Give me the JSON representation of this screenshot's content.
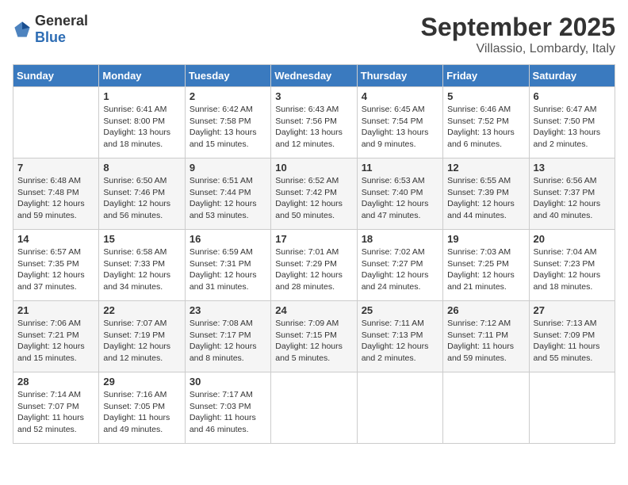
{
  "header": {
    "logo_general": "General",
    "logo_blue": "Blue",
    "month": "September 2025",
    "location": "Villassio, Lombardy, Italy"
  },
  "weekdays": [
    "Sunday",
    "Monday",
    "Tuesday",
    "Wednesday",
    "Thursday",
    "Friday",
    "Saturday"
  ],
  "weeks": [
    [
      {
        "day": "",
        "sunrise": "",
        "sunset": "",
        "daylight": ""
      },
      {
        "day": "1",
        "sunrise": "Sunrise: 6:41 AM",
        "sunset": "Sunset: 8:00 PM",
        "daylight": "Daylight: 13 hours and 18 minutes."
      },
      {
        "day": "2",
        "sunrise": "Sunrise: 6:42 AM",
        "sunset": "Sunset: 7:58 PM",
        "daylight": "Daylight: 13 hours and 15 minutes."
      },
      {
        "day": "3",
        "sunrise": "Sunrise: 6:43 AM",
        "sunset": "Sunset: 7:56 PM",
        "daylight": "Daylight: 13 hours and 12 minutes."
      },
      {
        "day": "4",
        "sunrise": "Sunrise: 6:45 AM",
        "sunset": "Sunset: 7:54 PM",
        "daylight": "Daylight: 13 hours and 9 minutes."
      },
      {
        "day": "5",
        "sunrise": "Sunrise: 6:46 AM",
        "sunset": "Sunset: 7:52 PM",
        "daylight": "Daylight: 13 hours and 6 minutes."
      },
      {
        "day": "6",
        "sunrise": "Sunrise: 6:47 AM",
        "sunset": "Sunset: 7:50 PM",
        "daylight": "Daylight: 13 hours and 2 minutes."
      }
    ],
    [
      {
        "day": "7",
        "sunrise": "Sunrise: 6:48 AM",
        "sunset": "Sunset: 7:48 PM",
        "daylight": "Daylight: 12 hours and 59 minutes."
      },
      {
        "day": "8",
        "sunrise": "Sunrise: 6:50 AM",
        "sunset": "Sunset: 7:46 PM",
        "daylight": "Daylight: 12 hours and 56 minutes."
      },
      {
        "day": "9",
        "sunrise": "Sunrise: 6:51 AM",
        "sunset": "Sunset: 7:44 PM",
        "daylight": "Daylight: 12 hours and 53 minutes."
      },
      {
        "day": "10",
        "sunrise": "Sunrise: 6:52 AM",
        "sunset": "Sunset: 7:42 PM",
        "daylight": "Daylight: 12 hours and 50 minutes."
      },
      {
        "day": "11",
        "sunrise": "Sunrise: 6:53 AM",
        "sunset": "Sunset: 7:40 PM",
        "daylight": "Daylight: 12 hours and 47 minutes."
      },
      {
        "day": "12",
        "sunrise": "Sunrise: 6:55 AM",
        "sunset": "Sunset: 7:39 PM",
        "daylight": "Daylight: 12 hours and 44 minutes."
      },
      {
        "day": "13",
        "sunrise": "Sunrise: 6:56 AM",
        "sunset": "Sunset: 7:37 PM",
        "daylight": "Daylight: 12 hours and 40 minutes."
      }
    ],
    [
      {
        "day": "14",
        "sunrise": "Sunrise: 6:57 AM",
        "sunset": "Sunset: 7:35 PM",
        "daylight": "Daylight: 12 hours and 37 minutes."
      },
      {
        "day": "15",
        "sunrise": "Sunrise: 6:58 AM",
        "sunset": "Sunset: 7:33 PM",
        "daylight": "Daylight: 12 hours and 34 minutes."
      },
      {
        "day": "16",
        "sunrise": "Sunrise: 6:59 AM",
        "sunset": "Sunset: 7:31 PM",
        "daylight": "Daylight: 12 hours and 31 minutes."
      },
      {
        "day": "17",
        "sunrise": "Sunrise: 7:01 AM",
        "sunset": "Sunset: 7:29 PM",
        "daylight": "Daylight: 12 hours and 28 minutes."
      },
      {
        "day": "18",
        "sunrise": "Sunrise: 7:02 AM",
        "sunset": "Sunset: 7:27 PM",
        "daylight": "Daylight: 12 hours and 24 minutes."
      },
      {
        "day": "19",
        "sunrise": "Sunrise: 7:03 AM",
        "sunset": "Sunset: 7:25 PM",
        "daylight": "Daylight: 12 hours and 21 minutes."
      },
      {
        "day": "20",
        "sunrise": "Sunrise: 7:04 AM",
        "sunset": "Sunset: 7:23 PM",
        "daylight": "Daylight: 12 hours and 18 minutes."
      }
    ],
    [
      {
        "day": "21",
        "sunrise": "Sunrise: 7:06 AM",
        "sunset": "Sunset: 7:21 PM",
        "daylight": "Daylight: 12 hours and 15 minutes."
      },
      {
        "day": "22",
        "sunrise": "Sunrise: 7:07 AM",
        "sunset": "Sunset: 7:19 PM",
        "daylight": "Daylight: 12 hours and 12 minutes."
      },
      {
        "day": "23",
        "sunrise": "Sunrise: 7:08 AM",
        "sunset": "Sunset: 7:17 PM",
        "daylight": "Daylight: 12 hours and 8 minutes."
      },
      {
        "day": "24",
        "sunrise": "Sunrise: 7:09 AM",
        "sunset": "Sunset: 7:15 PM",
        "daylight": "Daylight: 12 hours and 5 minutes."
      },
      {
        "day": "25",
        "sunrise": "Sunrise: 7:11 AM",
        "sunset": "Sunset: 7:13 PM",
        "daylight": "Daylight: 12 hours and 2 minutes."
      },
      {
        "day": "26",
        "sunrise": "Sunrise: 7:12 AM",
        "sunset": "Sunset: 7:11 PM",
        "daylight": "Daylight: 11 hours and 59 minutes."
      },
      {
        "day": "27",
        "sunrise": "Sunrise: 7:13 AM",
        "sunset": "Sunset: 7:09 PM",
        "daylight": "Daylight: 11 hours and 55 minutes."
      }
    ],
    [
      {
        "day": "28",
        "sunrise": "Sunrise: 7:14 AM",
        "sunset": "Sunset: 7:07 PM",
        "daylight": "Daylight: 11 hours and 52 minutes."
      },
      {
        "day": "29",
        "sunrise": "Sunrise: 7:16 AM",
        "sunset": "Sunset: 7:05 PM",
        "daylight": "Daylight: 11 hours and 49 minutes."
      },
      {
        "day": "30",
        "sunrise": "Sunrise: 7:17 AM",
        "sunset": "Sunset: 7:03 PM",
        "daylight": "Daylight: 11 hours and 46 minutes."
      },
      {
        "day": "",
        "sunrise": "",
        "sunset": "",
        "daylight": ""
      },
      {
        "day": "",
        "sunrise": "",
        "sunset": "",
        "daylight": ""
      },
      {
        "day": "",
        "sunrise": "",
        "sunset": "",
        "daylight": ""
      },
      {
        "day": "",
        "sunrise": "",
        "sunset": "",
        "daylight": ""
      }
    ]
  ]
}
